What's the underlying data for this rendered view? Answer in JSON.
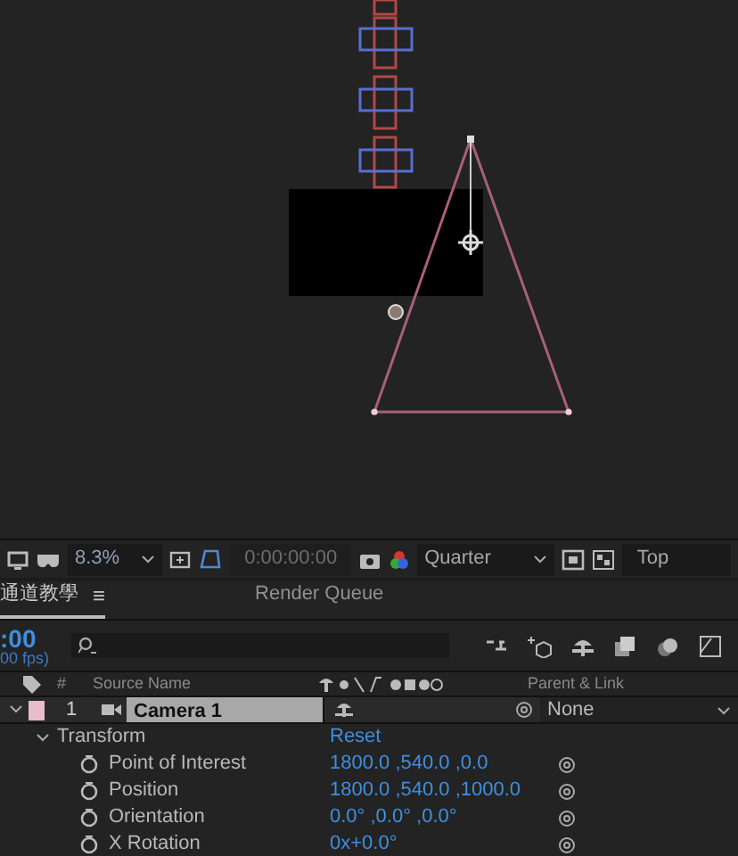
{
  "viewer_toolbar": {
    "zoom": "8.3%",
    "timecode": "0:00:00:00",
    "resolution": "Quarter",
    "view": "Top"
  },
  "panel_tabs": [
    {
      "label": "通道教學",
      "selected": true,
      "menu": "≡"
    },
    {
      "label": "Render Queue",
      "selected": false
    }
  ],
  "timeline": {
    "timecode": ":00",
    "fps": "00 fps)",
    "columns": {
      "number": "#",
      "source_name": "Source Name",
      "parent": "Parent & Link"
    },
    "layers": [
      {
        "number": "1",
        "name": "Camera 1",
        "color": "#e8bccb",
        "expanded": true,
        "parent": "None",
        "selected": true
      }
    ],
    "groups": [
      {
        "name": "Transform",
        "action": "Reset",
        "expanded": true,
        "properties": [
          {
            "name": "Point of Interest",
            "value": "1800.0 ,540.0 ,0.0"
          },
          {
            "name": "Position",
            "value": "1800.0 ,540.0 ,1000.0"
          },
          {
            "name": "Orientation",
            "value": "0.0° ,0.0° ,0.0°"
          },
          {
            "name": "X Rotation",
            "value": "0x+0.0°"
          }
        ]
      }
    ]
  }
}
